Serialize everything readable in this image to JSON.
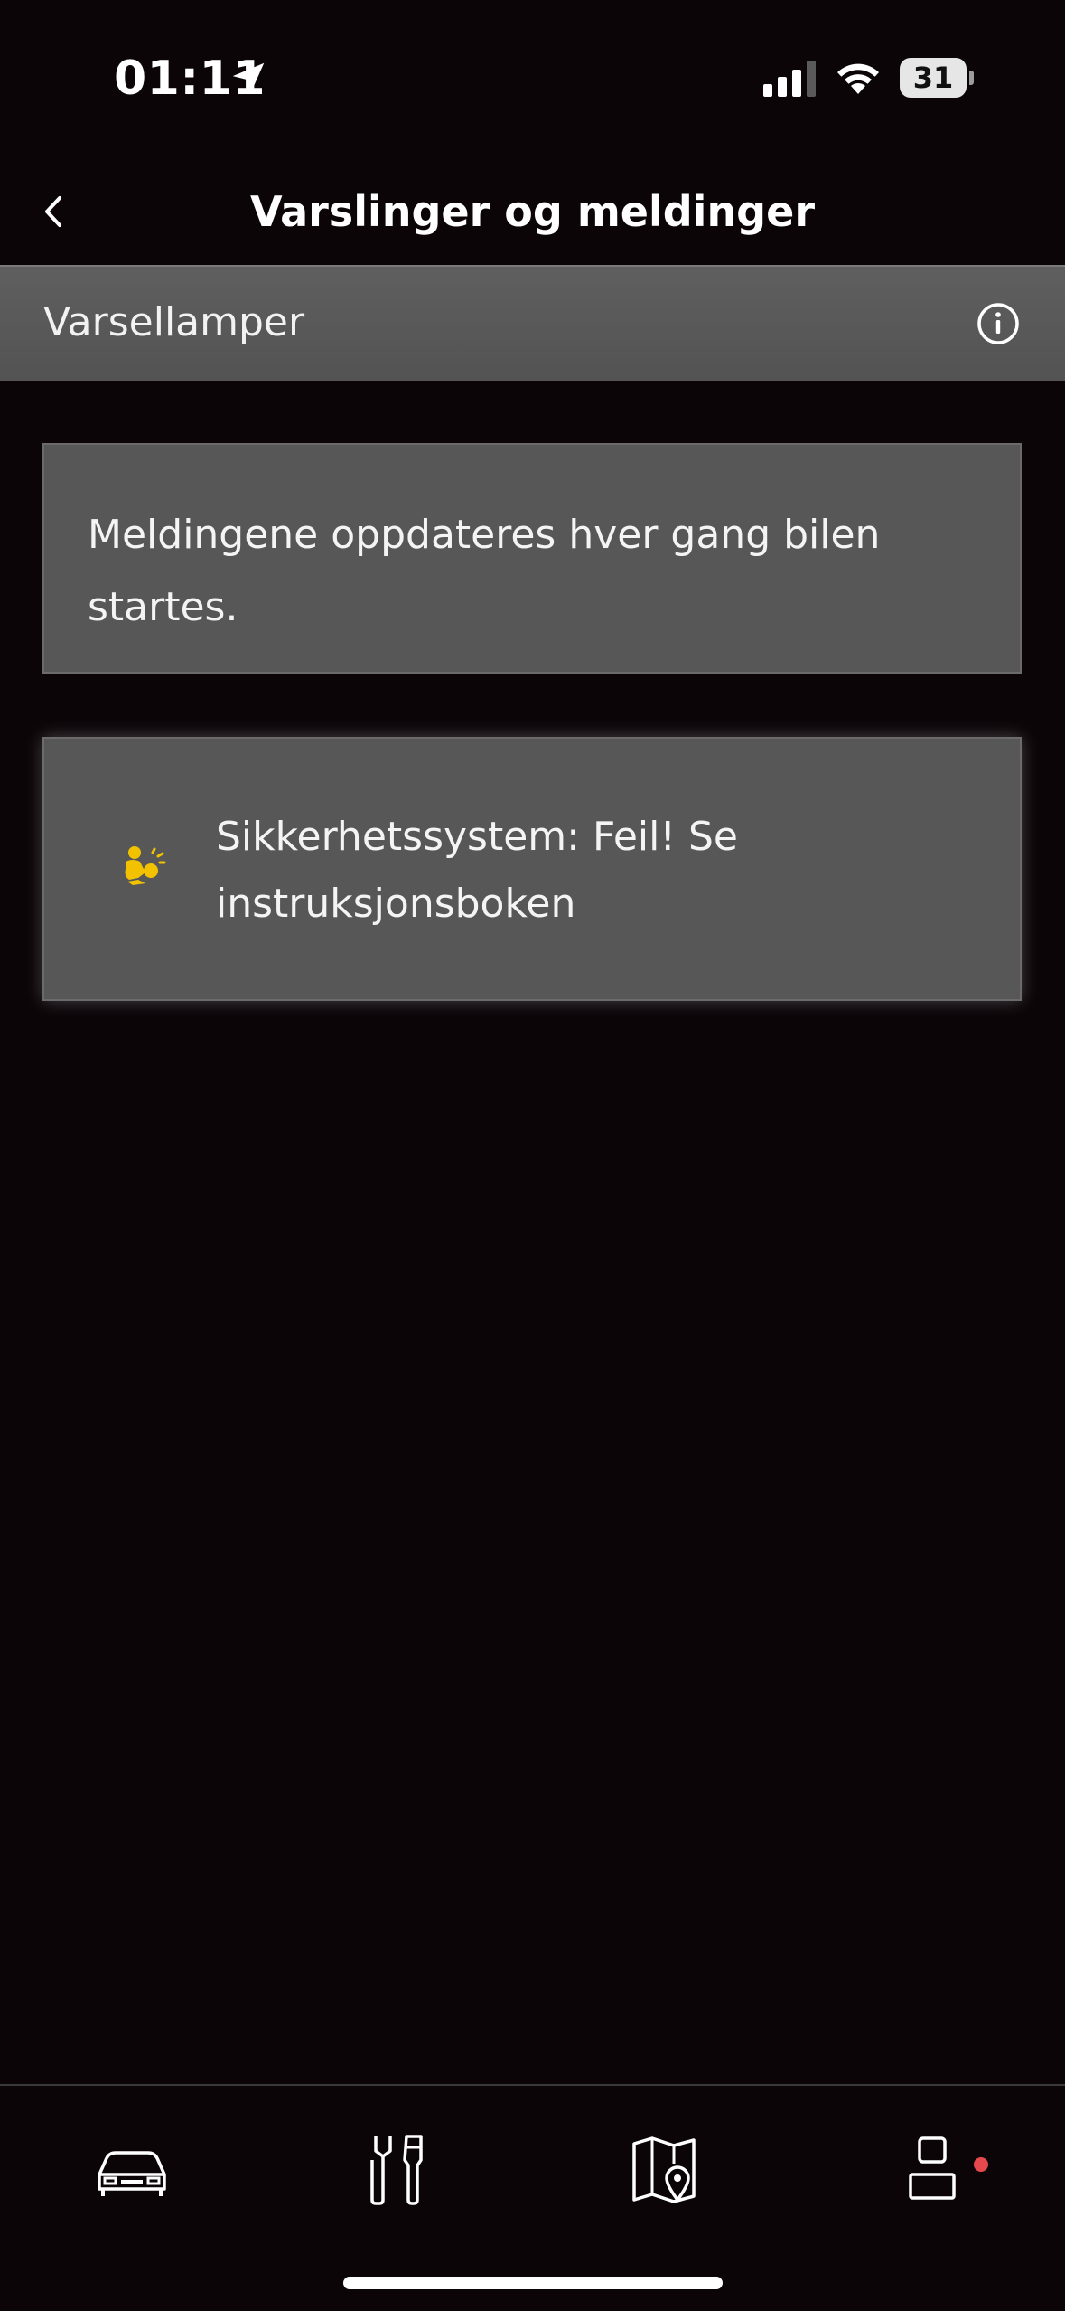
{
  "status_bar": {
    "time": "01:11",
    "battery_level": "31",
    "icons": [
      "location-arrow-icon",
      "cellular-signal-icon",
      "wifi-icon",
      "battery-icon"
    ]
  },
  "header": {
    "title": "Varslinger og meldinger",
    "back_icon": "chevron-left-icon"
  },
  "section": {
    "title": "Varsellamper",
    "info_icon": "info-icon"
  },
  "info_card": {
    "text": "Meldingene oppdateres hver gang bilen startes."
  },
  "warnings": [
    {
      "icon": "airbag-warning-icon",
      "text": "Sikkerhetssystem: Feil! Se instruksjonsboken",
      "icon_color": "#f2c200"
    }
  ],
  "bottom_nav": {
    "items": [
      {
        "name": "car",
        "icon": "car-icon"
      },
      {
        "name": "service",
        "icon": "service-tools-icon"
      },
      {
        "name": "map",
        "icon": "map-icon"
      },
      {
        "name": "profile",
        "icon": "profile-icon",
        "notification_dot": true
      }
    ],
    "notification_color": "#e5484d"
  },
  "colors": {
    "background": "#0b0508",
    "card": "#575757",
    "section_bar": "#5a5a5a",
    "text": "#ffffff",
    "warning_icon": "#f2c200"
  }
}
